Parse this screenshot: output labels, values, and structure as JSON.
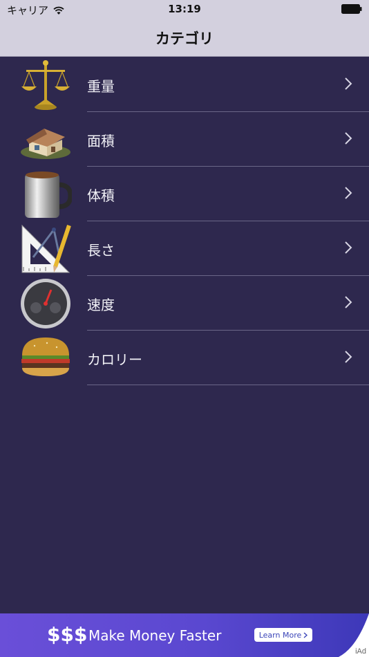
{
  "status_bar": {
    "carrier": "キャリア",
    "time": "13:19"
  },
  "nav": {
    "title": "カテゴリ"
  },
  "categories": [
    {
      "label": "重量",
      "icon": "scale-icon"
    },
    {
      "label": "面積",
      "icon": "house-icon"
    },
    {
      "label": "体積",
      "icon": "mug-icon"
    },
    {
      "label": "長さ",
      "icon": "compass-ruler-icon"
    },
    {
      "label": "速度",
      "icon": "speedometer-icon"
    },
    {
      "label": "カロリー",
      "icon": "burger-icon"
    }
  ],
  "ad": {
    "dollars": "$$$",
    "headline": "Make Money Faster",
    "cta": "Learn More",
    "label": "iAd"
  },
  "colors": {
    "background": "#2e284e",
    "bar": "#d3d0de",
    "ad_gradient_start": "#6a4fd8",
    "ad_gradient_end": "#3d38b8"
  }
}
